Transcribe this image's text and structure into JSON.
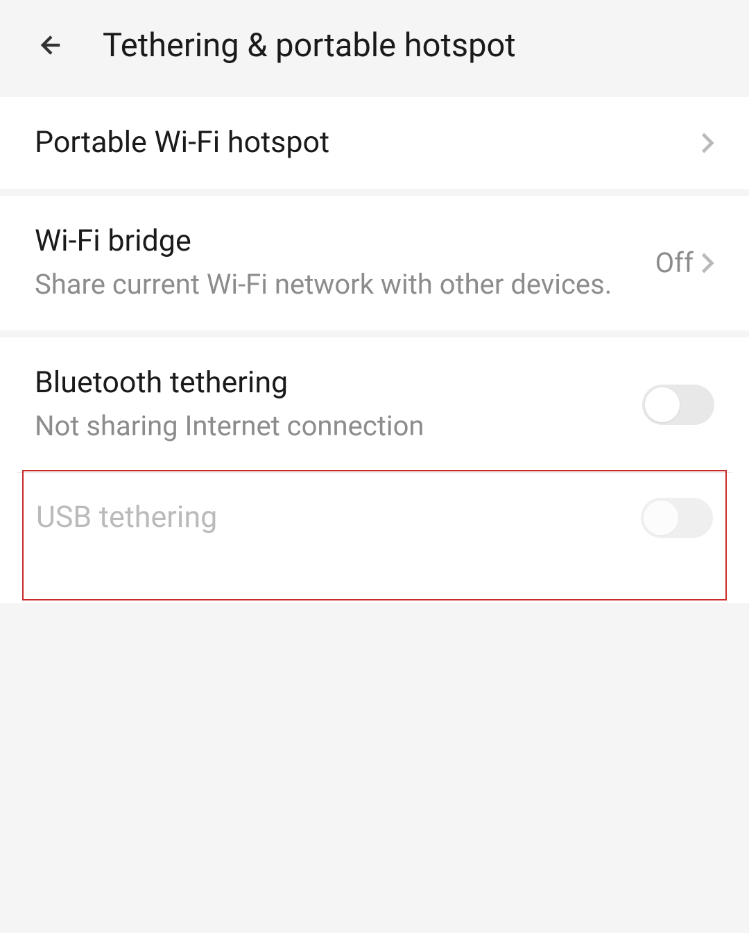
{
  "header": {
    "title": "Tethering & portable hotspot"
  },
  "items": {
    "portable_hotspot": {
      "title": "Portable Wi-Fi hotspot"
    },
    "wifi_bridge": {
      "title": "Wi-Fi bridge",
      "subtitle": "Share current Wi-Fi network with other devices.",
      "value": "Off"
    },
    "bluetooth_tethering": {
      "title": "Bluetooth tethering",
      "subtitle": "Not sharing Internet connection"
    },
    "usb_tethering": {
      "title": "USB tethering"
    }
  }
}
